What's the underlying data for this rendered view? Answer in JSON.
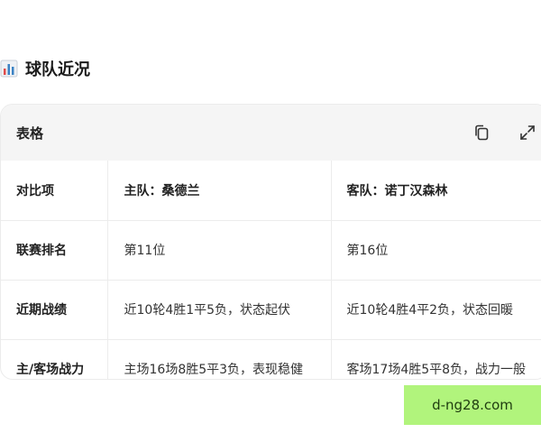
{
  "section": {
    "title": "球队近况",
    "icon": "bar-chart-icon"
  },
  "card": {
    "title": "表格",
    "icons": {
      "copy": "copy-icon",
      "expand": "expand-icon"
    }
  },
  "table": {
    "headers": [
      "对比项",
      "主队：桑德兰",
      "客队：诺丁汉森林"
    ],
    "rows": [
      [
        "联赛排名",
        "第11位",
        "第16位"
      ],
      [
        "近期战绩",
        "近10轮4胜1平5负，状态起伏",
        "近10轮4胜4平2负，状态回暖"
      ],
      [
        "主/客场战力",
        "主场16场8胜5平3负，表现稳健",
        "客场17场4胜5平8负，战力一般"
      ]
    ]
  },
  "watermark": {
    "text": "d-ng28.com",
    "color": "#b1f47c"
  }
}
